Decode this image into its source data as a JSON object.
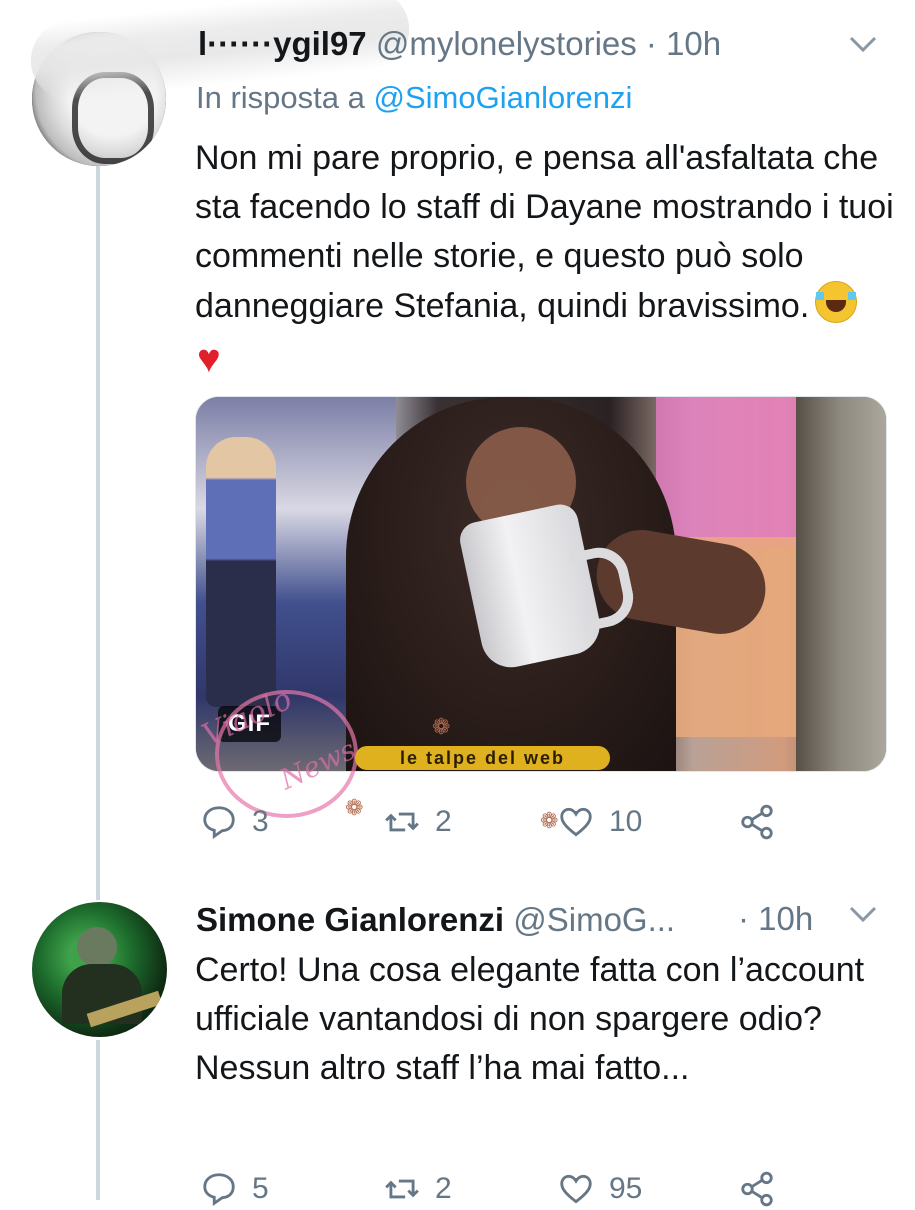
{
  "tweet1": {
    "name": "l······ygi⁠l97",
    "handle": "@mylonelystories",
    "time": "· 10h",
    "reply_prefix": "In risposta a",
    "reply_to": "@SimoGianlorenzi",
    "text": "Non mi pare proprio, e pensa all'asfaltata che sta facendo lo staff di Dayane mostrando i tuoi commenti nelle storie, e questo può solo danneggiare Stefania, quindi bravissimo.",
    "media_badge": "GIF",
    "replies": "3",
    "retweets": "2",
    "likes": "10"
  },
  "tweet2": {
    "name": "Simone Gianlorenzi",
    "handle": "@SimoG...",
    "time": "· 10h",
    "text": "Certo! Una cosa elegante fatta con l’account ufficiale vantandosi di non spargere odio? Nessun altro staff l’ha mai fatto...",
    "replies": "5",
    "retweets": "2",
    "likes": "95"
  },
  "watermarks": {
    "logo1_line1": "Viaolo",
    "logo1_line2": "News",
    "logo2": "le talpe del web"
  },
  "icons": {
    "reply": "reply-icon",
    "retweet": "retweet-icon",
    "like": "heart-icon",
    "share": "share-icon",
    "caret": "chevron-down-icon"
  }
}
